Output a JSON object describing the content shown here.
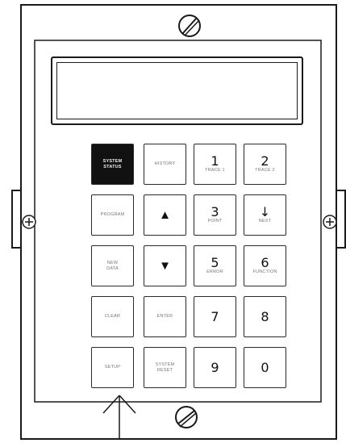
{
  "keys": {
    "system_status": {
      "line1": "SYSTEM",
      "line2": "STATUS"
    },
    "history": {
      "label": "HISTORY"
    },
    "key1": {
      "digit": "1",
      "sub": "TRACE 1"
    },
    "key2": {
      "digit": "2",
      "sub": "TRACE 2"
    },
    "program": {
      "label": "PROGRAM"
    },
    "up": {
      "glyph": "▲"
    },
    "key3": {
      "digit": "3",
      "sub": "POINT"
    },
    "key_arrow": {
      "digit": "↓",
      "sub": "NEXT"
    },
    "new_data": {
      "line1": "NEW",
      "line2": "DATA"
    },
    "down": {
      "glyph": "▼"
    },
    "key5": {
      "digit": "5",
      "sub": "ERROR"
    },
    "key6": {
      "digit": "6",
      "sub": "FUNCTION"
    },
    "clear": {
      "label": "CLEAR"
    },
    "enter": {
      "label": "ENTER"
    },
    "key7": {
      "digit": "7"
    },
    "key8": {
      "digit": "8"
    },
    "setup": {
      "label": "SETUP"
    },
    "system_reset": {
      "line1": "SYSTEM",
      "line2": "RESET"
    },
    "key9": {
      "digit": "9"
    },
    "key0": {
      "digit": "0"
    }
  }
}
